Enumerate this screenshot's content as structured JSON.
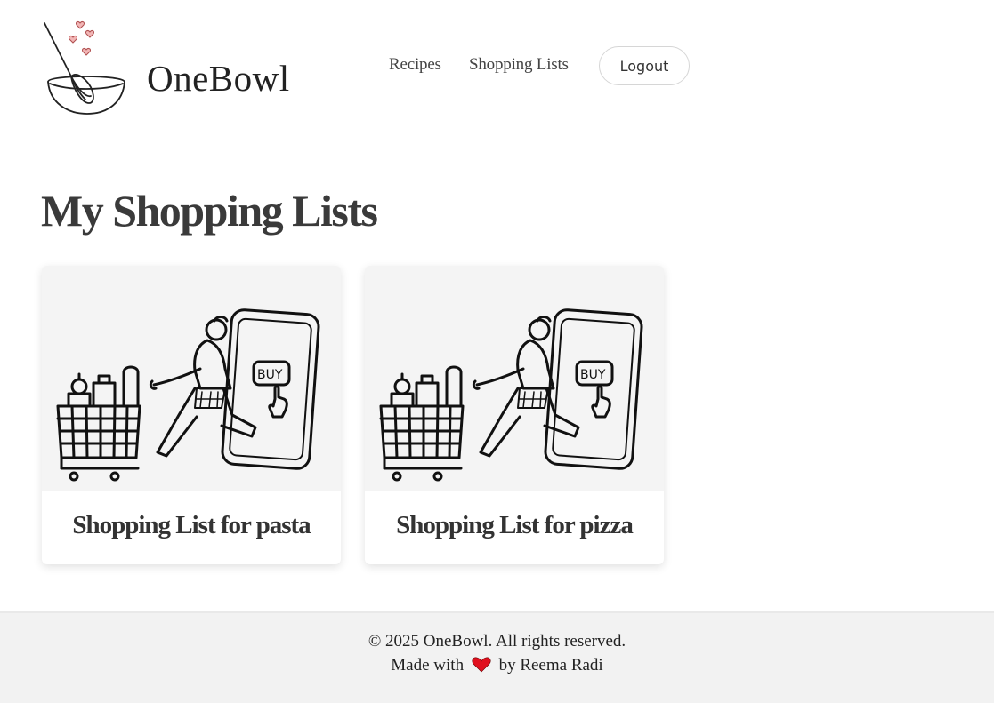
{
  "header": {
    "brand": "OneBowl",
    "nav": [
      {
        "label": "Recipes"
      },
      {
        "label": "Shopping Lists"
      }
    ],
    "logout_label": "Logout"
  },
  "main": {
    "title": "My Shopping Lists",
    "cards": [
      {
        "title": "Shopping List for pasta",
        "image_icon": "shopping-cart-illustration"
      },
      {
        "title": "Shopping List for pizza",
        "image_icon": "shopping-cart-illustration"
      }
    ]
  },
  "footer": {
    "copyright": "© 2025 OneBowl. All rights reserved.",
    "made_with_prefix": "Made with",
    "made_with_suffix": "by Reema Radi",
    "heart_color": "#e0101e"
  },
  "colors": {
    "text": "#333333",
    "footer_bg": "#f2f2f2"
  }
}
